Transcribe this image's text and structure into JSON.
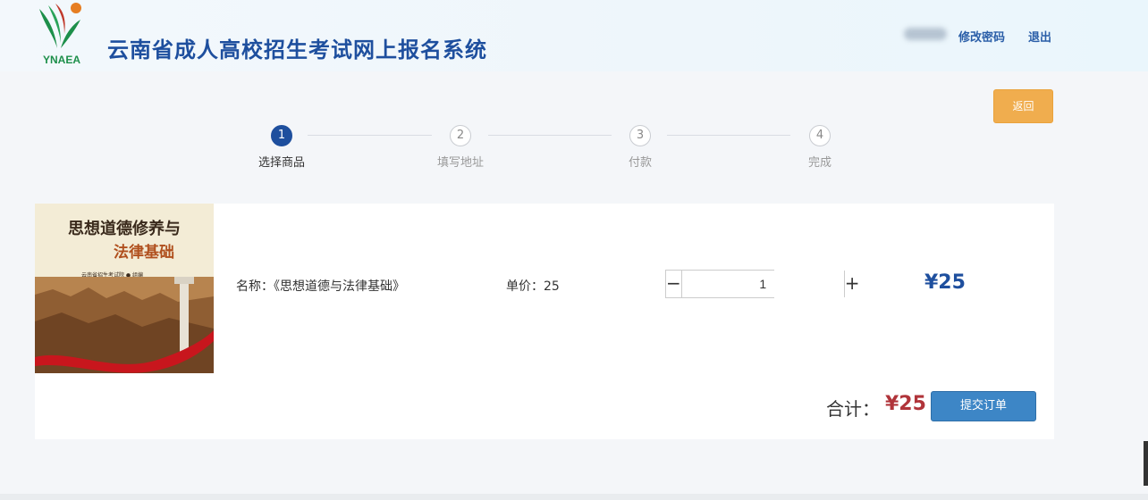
{
  "header": {
    "logo_text": "YNAEA",
    "site_title": "云南省成人高校招生考试网上报名系统",
    "change_password_label": "修改密码",
    "logout_label": "退出"
  },
  "back_button_label": "返回",
  "steps": [
    {
      "number": "1",
      "label": "选择商品",
      "active": true
    },
    {
      "number": "2",
      "label": "填写地址",
      "active": false
    },
    {
      "number": "3",
      "label": "付款",
      "active": false
    },
    {
      "number": "4",
      "label": "完成",
      "active": false
    }
  ],
  "product": {
    "cover_title": "思想道德修养与",
    "cover_subtitle": "法律基础",
    "cover_publisher": "云南省招生考试院 ● 组编",
    "name_text": "名称：《思想道德与法律基础》",
    "price_text": "单价：25",
    "quantity": "1",
    "minus_label": "−",
    "plus_label": "+",
    "line_total": "¥25"
  },
  "summary": {
    "total_label": "合计：",
    "total_value": "¥25",
    "submit_label": "提交订单"
  },
  "colors": {
    "brand_blue": "#1e4f9e",
    "back_button": "#f0ad4e",
    "submit_button": "#3d86c6",
    "total_red": "#b0343a"
  }
}
